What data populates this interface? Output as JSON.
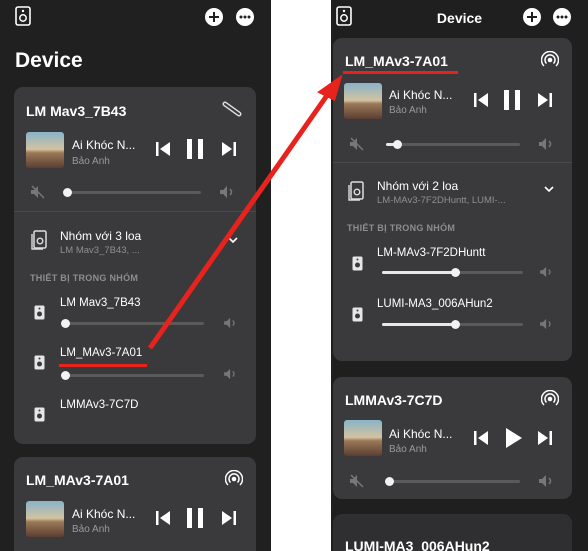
{
  "left": {
    "title": "Device",
    "card1": {
      "name": "LM Mav3_7B43",
      "track_title": "Ai Khóc N...",
      "artist": "Bảo Anh",
      "volume": 0.02,
      "group_label": "Nhóm với 3 loa",
      "group_sub": "LM Mav3_7B43, ...",
      "section": "THIẾT BỊ TRONG NHÓM",
      "devices": [
        {
          "name": "LM Mav3_7B43",
          "volume": 0.02
        },
        {
          "name": "LM_MAv3-7A01",
          "volume": 0.02
        },
        {
          "name": "LMMAv3-7C7D"
        }
      ]
    },
    "card2": {
      "name": "LM_MAv3-7A01",
      "track_title": "Ai Khóc N...",
      "artist": "Bảo Anh"
    }
  },
  "right": {
    "title": "Device",
    "card1": {
      "name": "LM_MAv3-7A01",
      "track_title": "Ai Khóc N...",
      "artist": "Bảo Anh",
      "volume": 0.08,
      "group_label": "Nhóm với 2 loa",
      "group_sub": "LM-MAv3-7F2DHuntt, LUMI-...",
      "section": "THIẾT BỊ TRONG NHÓM",
      "devices": [
        {
          "name": "LM-MAv3-7F2DHuntt",
          "volume": 0.52
        },
        {
          "name": "LUMI-MA3_006AHun2",
          "volume": 0.52
        }
      ]
    },
    "card2": {
      "name": "LMMAv3-7C7D",
      "track_title": "Ai Khóc N...",
      "artist": "Bảo Anh",
      "volume": 0.02
    },
    "card3": {
      "name": "LUMI-MA3_006AHun2"
    }
  },
  "colors": {
    "accent_red": "#e8231d",
    "card": "#3a3a3c",
    "background": "#202020"
  }
}
